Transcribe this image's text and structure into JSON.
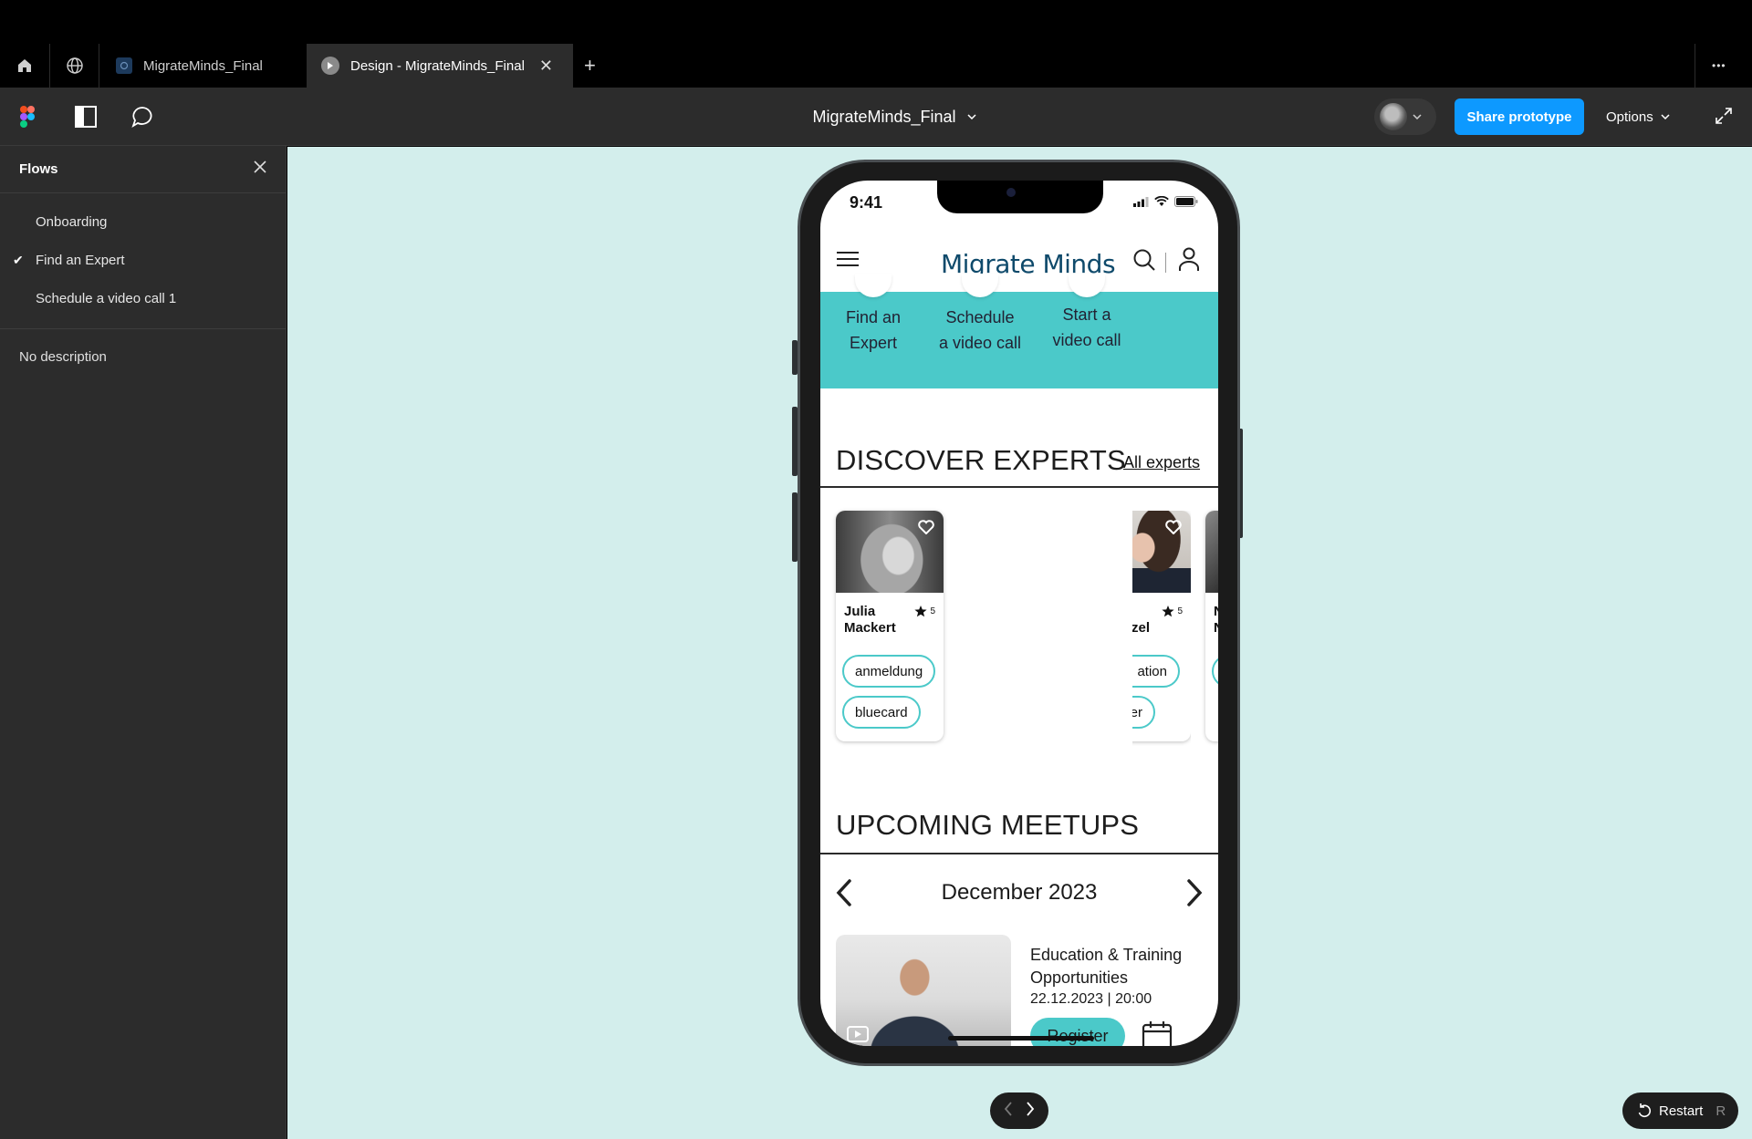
{
  "tabbar": {
    "tabs": [
      {
        "label": "MigrateMinds_Final",
        "active": false
      },
      {
        "label": "Design - MigrateMinds_Final",
        "active": true
      }
    ],
    "new_tab": "+",
    "more": "•••"
  },
  "toolbar": {
    "file_name": "MigrateMinds_Final",
    "share_label": "Share prototype",
    "options_label": "Options"
  },
  "sidebar": {
    "title": "Flows",
    "flows": [
      {
        "label": "Onboarding",
        "selected": false
      },
      {
        "label": "Find an Expert",
        "selected": true
      },
      {
        "label": "Schedule a video call 1",
        "selected": false
      }
    ],
    "description": "No description"
  },
  "phone": {
    "status_time": "9:41",
    "brand": "Migrate Minds",
    "shortcuts": [
      {
        "line1": "Find an",
        "line2": "Expert"
      },
      {
        "line1": "Schedule",
        "line2": "a video call"
      },
      {
        "line1": "Start a",
        "line2": "video call"
      }
    ],
    "discover": {
      "title": "DISCOVER EXPERTS",
      "link": "All experts",
      "experts": [
        {
          "name_line1": "Julia",
          "name_line2": "Mackert",
          "rating": "5",
          "tags": [
            "anmeldung",
            "bluecard"
          ]
        },
        {
          "name_line1": "",
          "name_line2": "zel",
          "rating": "5",
          "tags": [
            "ation",
            "er"
          ]
        },
        {
          "name_line1": "N",
          "name_line2": "N",
          "rating": "",
          "tags": [
            ""
          ]
        }
      ]
    },
    "meetups": {
      "title": "UPCOMING MEETUPS",
      "month": "December 2023",
      "event": {
        "title_line1": "Education & Training",
        "title_line2": "Opportunities",
        "datetime": "22.12.2023 | 20:00",
        "register_label": "Register"
      }
    }
  },
  "controls": {
    "restart_label": "Restart",
    "restart_key": "R"
  },
  "colors": {
    "accent": "#0d99ff",
    "teal": "#4bc9c9",
    "brand": "#0f4a6b",
    "canvas": "#d3eeec"
  }
}
